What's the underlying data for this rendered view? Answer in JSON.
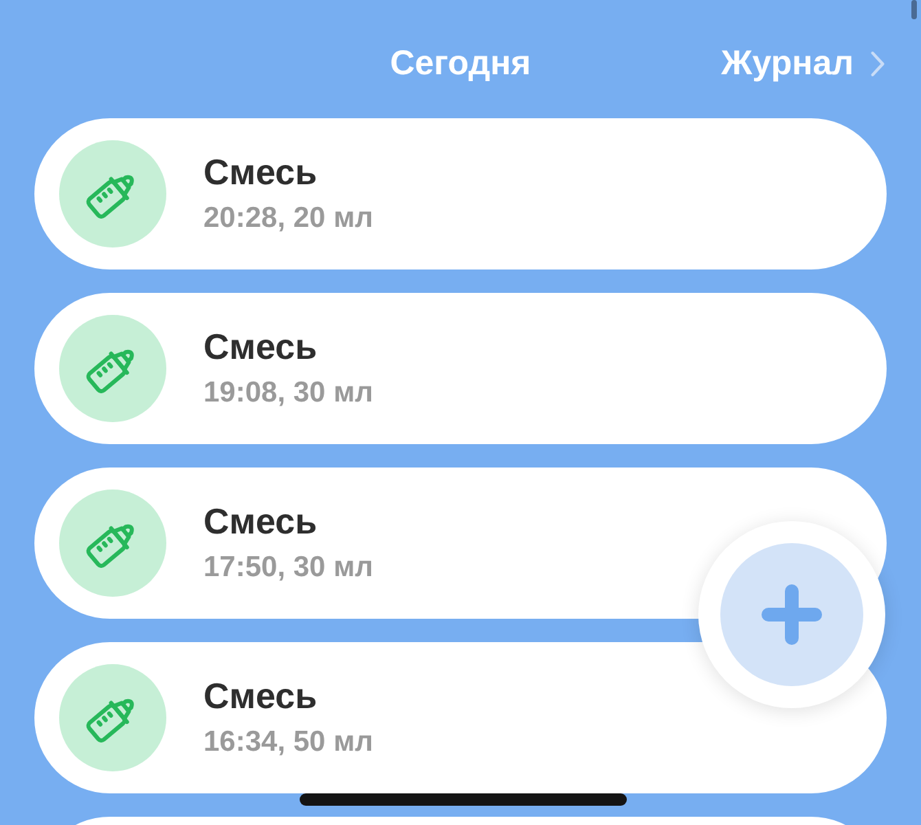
{
  "header": {
    "title": "Сегодня",
    "journal_link": "Журнал"
  },
  "entries": [
    {
      "title": "Смесь",
      "detail": "20:28, 20 мл"
    },
    {
      "title": "Смесь",
      "detail": "19:08, 30 мл"
    },
    {
      "title": "Смесь",
      "detail": "17:50, 30 мл"
    },
    {
      "title": "Смесь",
      "detail": "16:34, 50 мл"
    }
  ]
}
